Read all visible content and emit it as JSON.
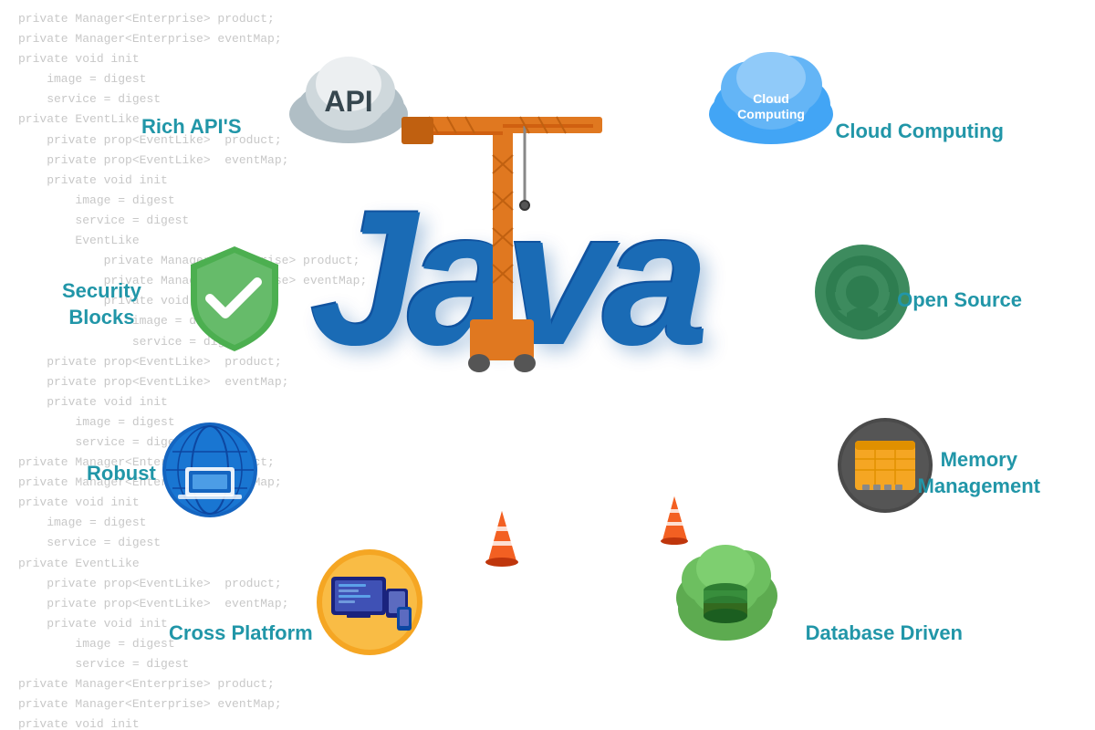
{
  "background_code": "private Manager<Enterprise> product;\nprivate Manager<Enterprise> eventMap;\nprivate void init\n    image = digest\n    service = digest\nprivate EventLike\n    private prop<EventLike>  product;\n    private prop<EventLike>  eventMap;\n    private void init\n        image = digest\n        service = digest\n        EventLike\n            private Manager<Enterprise> product;\n            private Manager<Enterprise> eventMap;\n            private void init\n                image = digest\n                service = digest\n    private prop<EventLike>  product;\n    private prop<EventLike>  eventMap;\n    private void init",
  "center_text": "Java",
  "labels": {
    "rich_api": "Rich API'S",
    "cloud_computing": "Cloud Computing",
    "security_blocks": "Security\nBlocks",
    "open_source": "Open Source",
    "robust": "Robust",
    "memory_management": "Memory\nManagement",
    "cross_platform": "Cross Platform",
    "database_driven": "Database Driven"
  },
  "cloud_labels": {
    "api": "API",
    "cloud_computing": "Cloud\nComputing"
  },
  "colors": {
    "label_blue": "#2196a8",
    "java_blue": "#1a6bb5",
    "crane_orange": "#e07820",
    "shield_green": "#4caf50",
    "open_source_green": "#3d8b5e",
    "globe_blue": "#1565c0",
    "memory_dark": "#4a4a4a",
    "cross_platform_gold": "#f5a623",
    "database_green": "#5dab50",
    "cloud_blue": "#42a5f5",
    "cloud_gray": "#b0bec5"
  }
}
